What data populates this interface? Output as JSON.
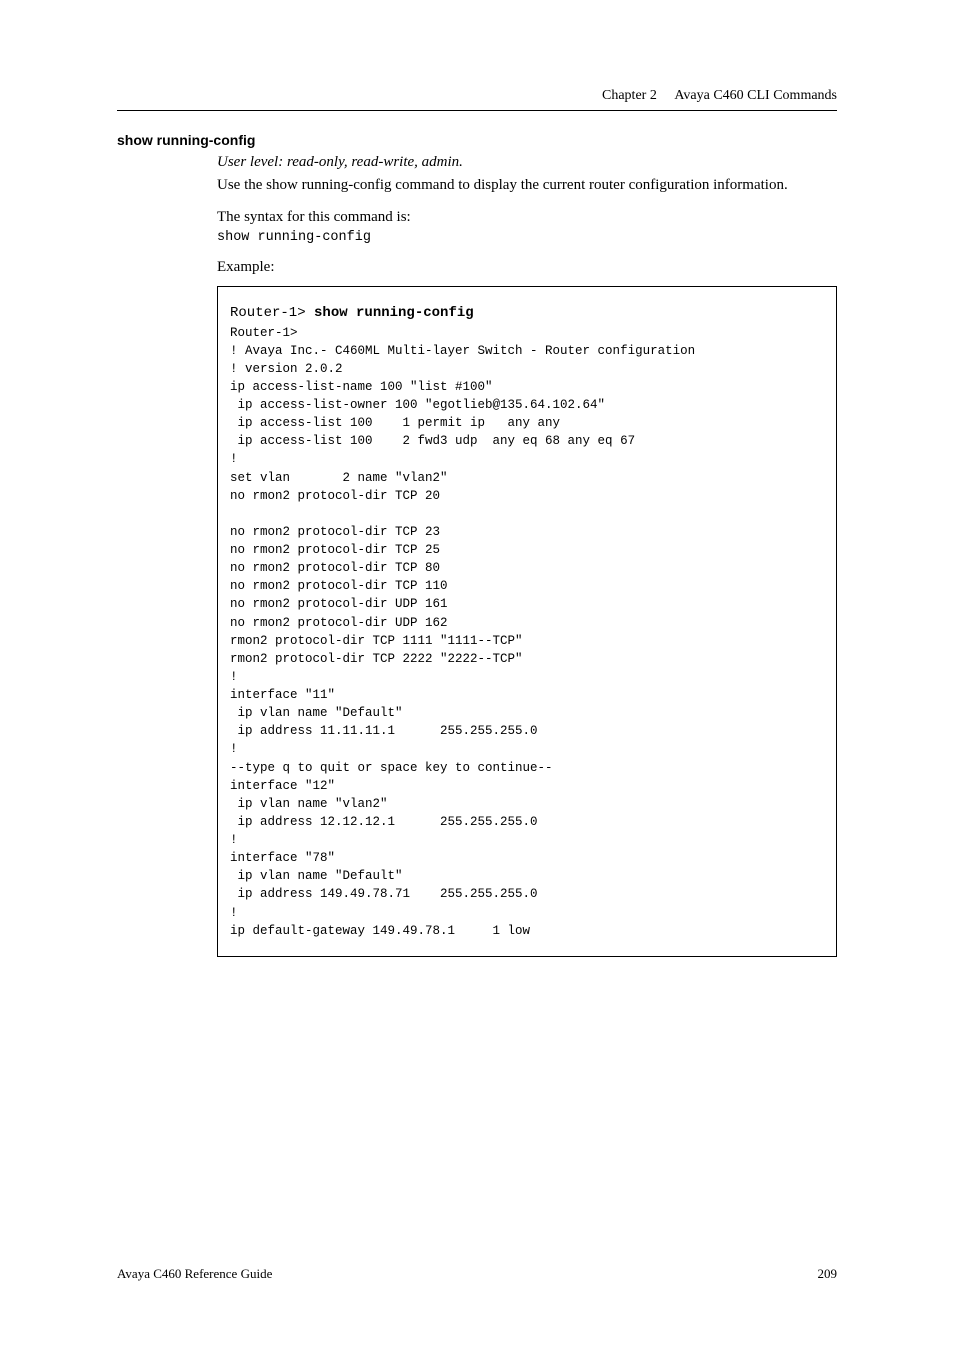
{
  "header": {
    "chapter": "Chapter 2",
    "title": "Avaya C460 CLI Commands"
  },
  "section": {
    "heading": "show running-config",
    "user_level": "User level: read-only, read-write, admin.",
    "intro_text": "Use the show running-config command to display the current router configuration information.",
    "syntax_label": "The syntax for this command is:",
    "syntax_command": "show running-config",
    "example_label": "Example:"
  },
  "example": {
    "prompt_line": "Router-1> ",
    "prompt_command": "show running-config",
    "body": "Router-1>\n! Avaya Inc.- C460ML Multi-layer Switch - Router configuration\n! version 2.0.2\nip access-list-name 100 \"list #100\"\n ip access-list-owner 100 \"egotlieb@135.64.102.64\"\n ip access-list 100    1 permit ip   any any\n ip access-list 100    2 fwd3 udp  any eq 68 any eq 67\n!\nset vlan       2 name \"vlan2\"\nno rmon2 protocol-dir TCP 20\n\nno rmon2 protocol-dir TCP 23\nno rmon2 protocol-dir TCP 25\nno rmon2 protocol-dir TCP 80\nno rmon2 protocol-dir TCP 110\nno rmon2 protocol-dir UDP 161\nno rmon2 protocol-dir UDP 162\nrmon2 protocol-dir TCP 1111 \"1111--TCP\"\nrmon2 protocol-dir TCP 2222 \"2222--TCP\"\n!\ninterface \"11\"\n ip vlan name \"Default\"\n ip address 11.11.11.1      255.255.255.0\n!\n--type q to quit or space key to continue--\ninterface \"12\"\n ip vlan name \"vlan2\"\n ip address 12.12.12.1      255.255.255.0\n!\ninterface \"78\"\n ip vlan name \"Default\"\n ip address 149.49.78.71    255.255.255.0\n!\nip default-gateway 149.49.78.1     1 low"
  },
  "footer": {
    "guide": "Avaya C460 Reference Guide",
    "page": "209"
  }
}
